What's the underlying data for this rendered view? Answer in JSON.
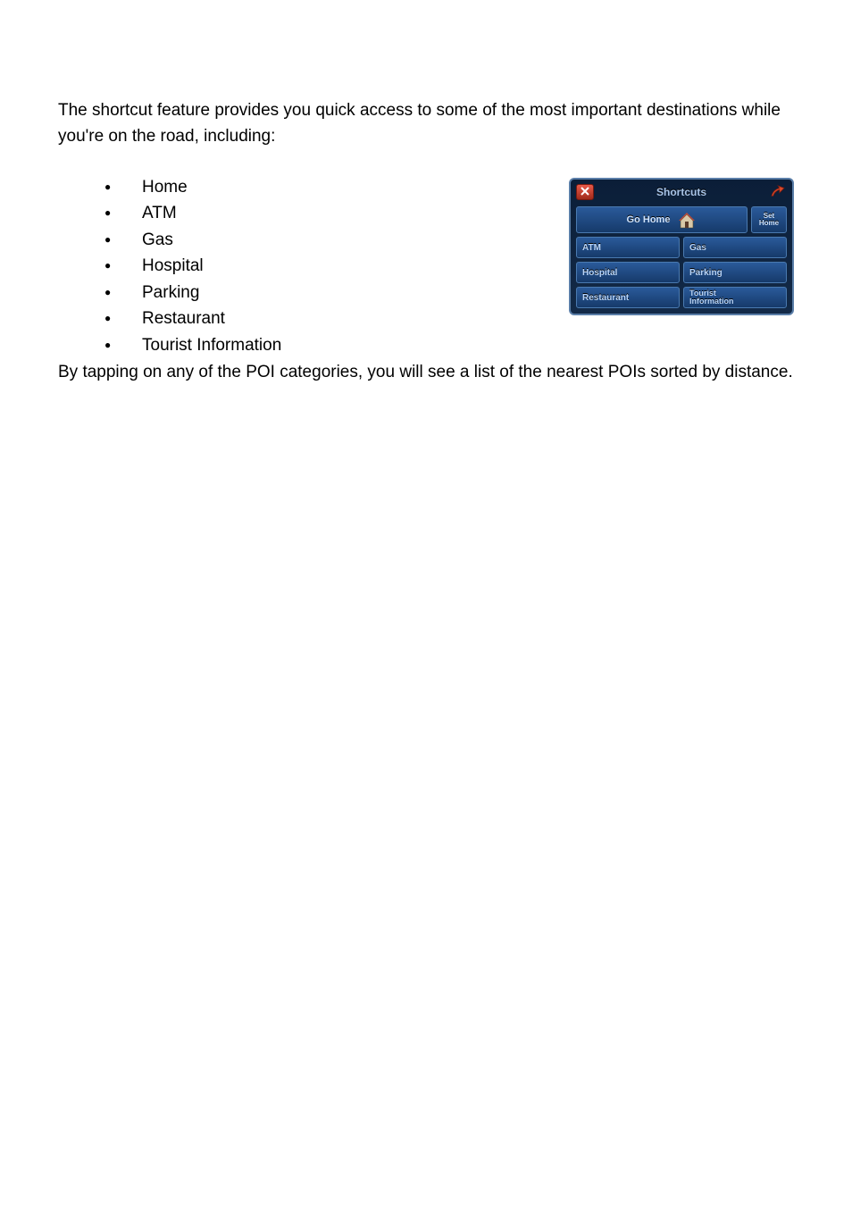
{
  "intro": "The shortcut feature provides you quick access to some of the most important destinations while you're on the road, including:",
  "bullets": [
    "Home",
    "ATM",
    "Gas",
    "Hospital",
    "Parking",
    "Restaurant",
    "Tourist Information"
  ],
  "outro": "By tapping on any of the POI categories, you will see a list of the nearest POIs sorted by distance.",
  "widget": {
    "title": "Shortcuts",
    "goHome": "Go Home",
    "setHome1": "Set",
    "setHome2": "Home",
    "grid": {
      "atm": "ATM",
      "gas": "Gas",
      "hospital": "Hospital",
      "parking": "Parking",
      "restaurant": "Restaurant",
      "tourist1": "Tourist",
      "tourist2": "Information"
    }
  }
}
